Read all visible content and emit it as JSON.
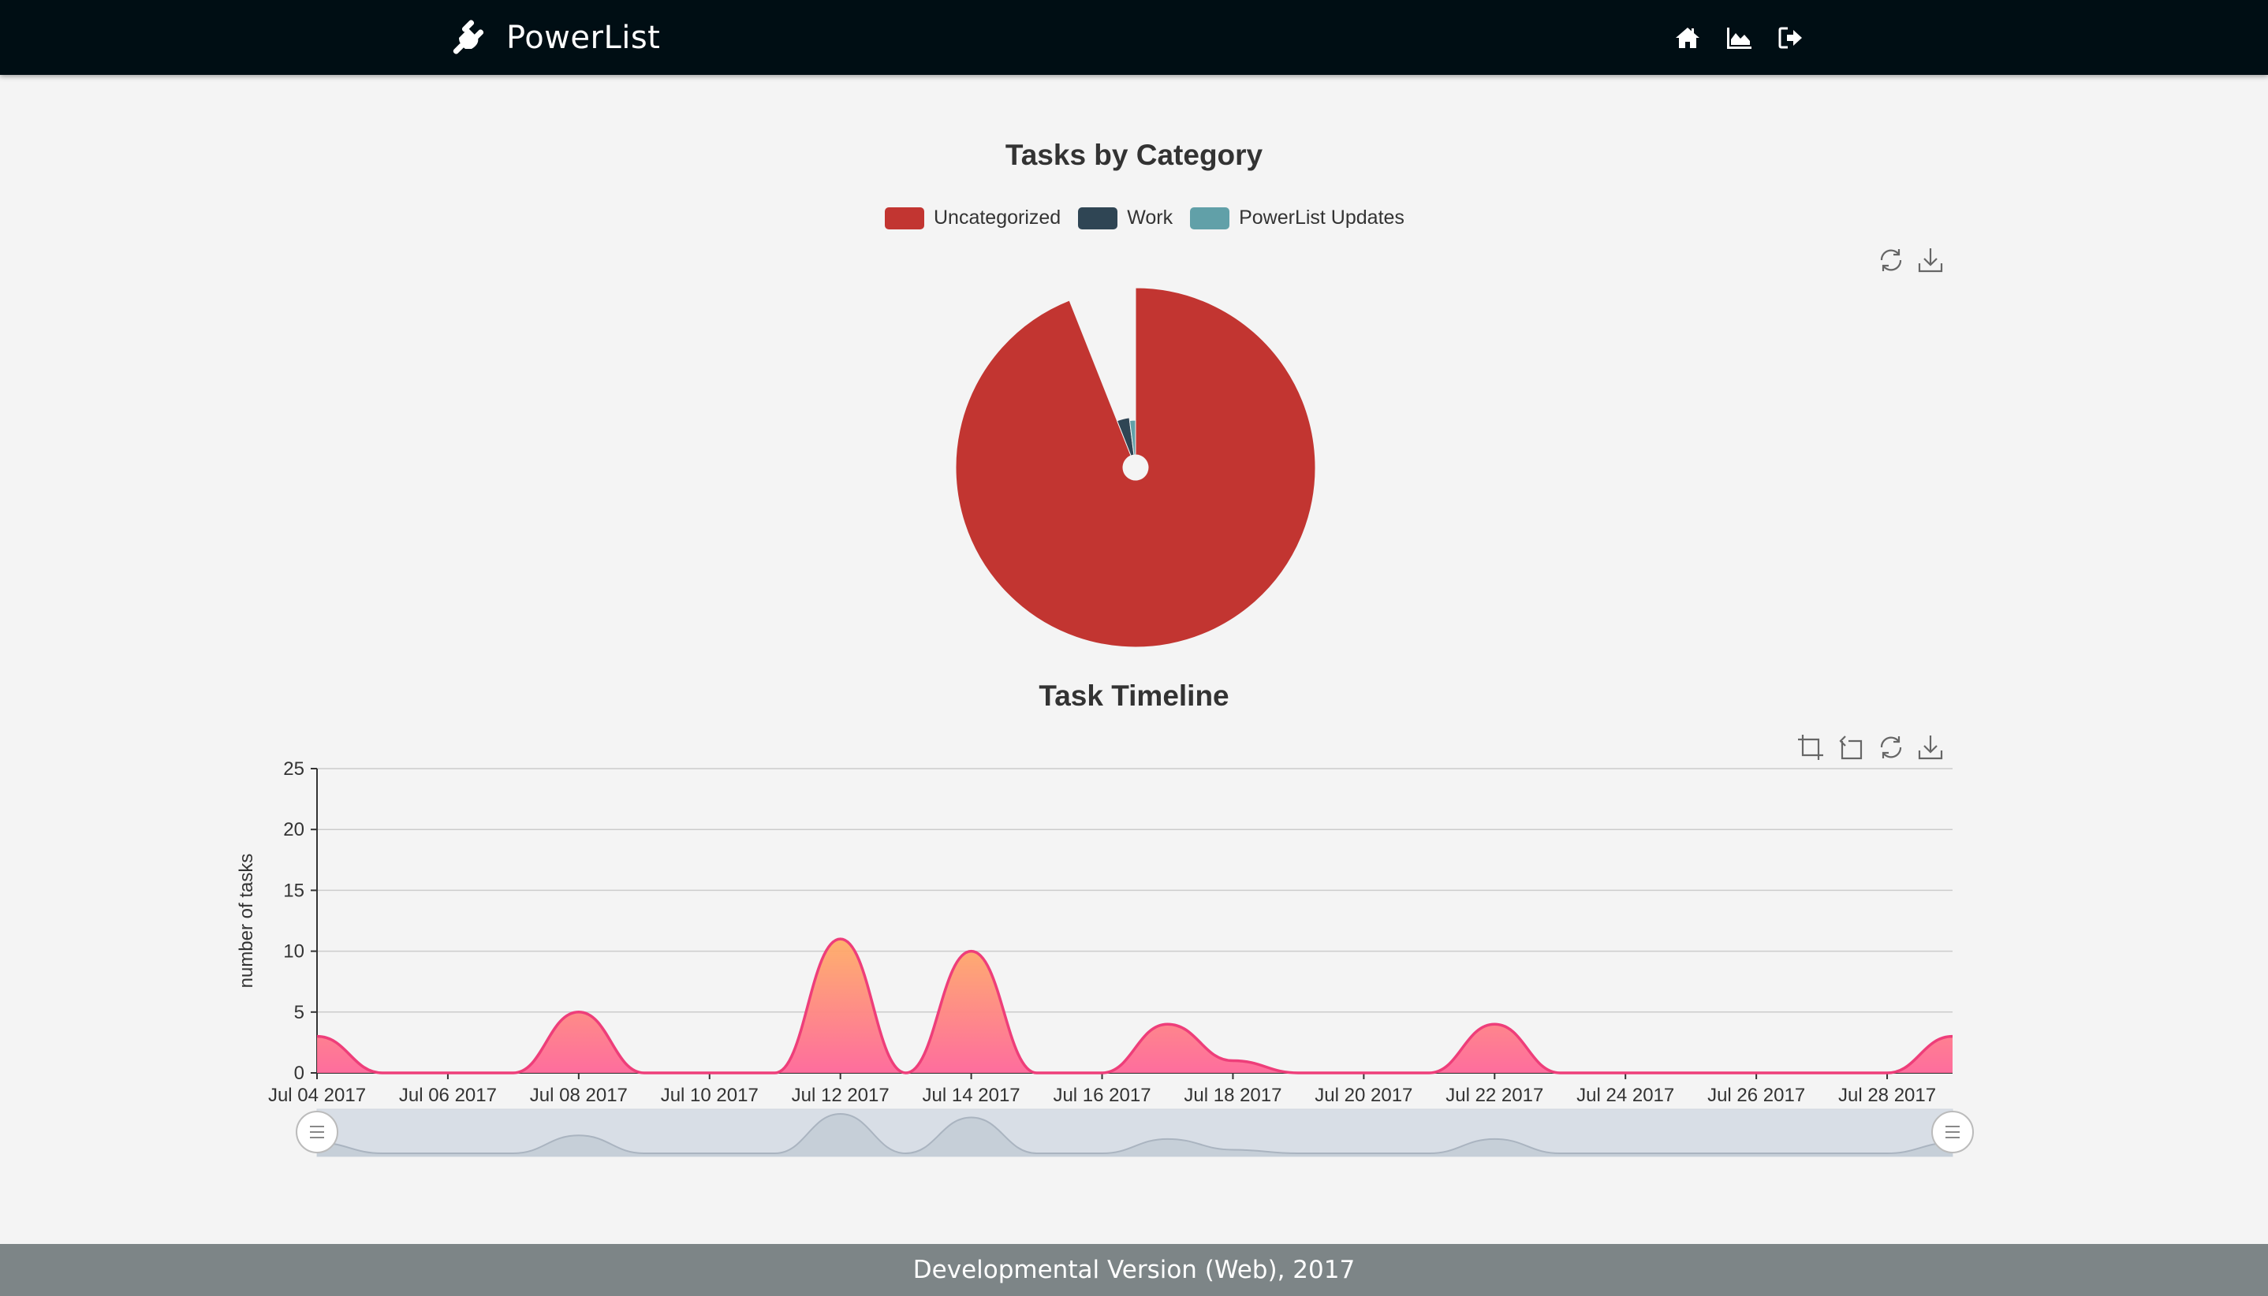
{
  "app": {
    "name": "PowerList",
    "logo_icon": "plug-icon",
    "nav": [
      {
        "name": "home",
        "icon": "home-icon"
      },
      {
        "name": "analytics",
        "icon": "area-chart-icon"
      },
      {
        "name": "logout",
        "icon": "sign-out-icon"
      }
    ]
  },
  "colors": {
    "topbar": "#000e14",
    "uncategorized": "#c23531",
    "work": "#2f4554",
    "powerlist_updates": "#61a0a8",
    "area_top": "#ffad66",
    "area_bottom": "#ff6699",
    "line": "#ee3e7a",
    "footer": "#7d8587"
  },
  "pie_section": {
    "title": "Tasks by Category",
    "toolbox": [
      "restore-icon",
      "download-icon"
    ]
  },
  "timeline_section": {
    "title": "Task Timeline",
    "toolbox": [
      "data-zoom-icon",
      "zoom-reset-icon",
      "restore-icon",
      "download-icon"
    ]
  },
  "chart_data": [
    {
      "type": "pie",
      "variant": "rose",
      "title": "Tasks by Category",
      "legend_position": "top",
      "categories": [
        "Uncategorized",
        "Work",
        "PowerList Updates"
      ],
      "values": [
        47,
        2,
        1
      ]
    },
    {
      "type": "area",
      "title": "Task Timeline",
      "xlabel": "",
      "ylabel": "number of tasks",
      "ylim": [
        0,
        25
      ],
      "yticks": [
        "0",
        "5",
        "10",
        "15",
        "20",
        "25"
      ],
      "grid": true,
      "smooth": true,
      "x_tick_labels": [
        "Jul 04 2017",
        "Jul 06 2017",
        "Jul 08 2017",
        "Jul 10 2017",
        "Jul 12 2017",
        "Jul 14 2017",
        "Jul 16 2017",
        "Jul 18 2017",
        "Jul 20 2017",
        "Jul 22 2017",
        "Jul 24 2017",
        "Jul 26 2017",
        "Jul 28 2017"
      ],
      "x": [
        "Jul 04 2017",
        "Jul 05 2017",
        "Jul 06 2017",
        "Jul 07 2017",
        "Jul 08 2017",
        "Jul 09 2017",
        "Jul 10 2017",
        "Jul 11 2017",
        "Jul 12 2017",
        "Jul 13 2017",
        "Jul 14 2017",
        "Jul 15 2017",
        "Jul 16 2017",
        "Jul 17 2017",
        "Jul 18 2017",
        "Jul 19 2017",
        "Jul 20 2017",
        "Jul 21 2017",
        "Jul 22 2017",
        "Jul 23 2017",
        "Jul 24 2017",
        "Jul 25 2017",
        "Jul 26 2017",
        "Jul 27 2017",
        "Jul 28 2017",
        "Jul 29 2017"
      ],
      "series": [
        {
          "values": [
            3,
            0,
            0,
            0,
            5,
            0,
            0,
            0,
            11,
            0,
            10,
            0,
            0,
            4,
            1,
            0,
            0,
            0,
            4,
            0,
            0,
            0,
            0,
            0,
            0,
            3
          ]
        }
      ],
      "data_zoom": {
        "start_percent": 0,
        "end_percent": 100
      }
    }
  ],
  "footer": {
    "text": "Developmental Version (Web), 2017"
  }
}
